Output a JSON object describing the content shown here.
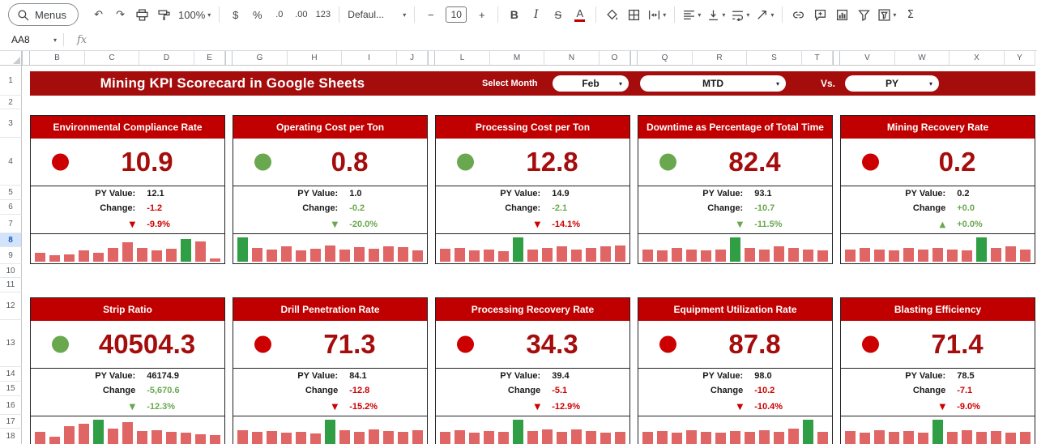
{
  "toolbar": {
    "menus_label": "Menus",
    "zoom_value": "100%",
    "currency_label": "$",
    "percent_label": "%",
    "decrease_decimal_label": ".0",
    "increase_decimal_label": ".00",
    "number_format_label": "123",
    "font_family_value": "Defaul...",
    "decrease_font_label": "−",
    "font_size_value": "10",
    "increase_font_label": "+",
    "bold_label": "B",
    "italic_label": "I",
    "strikethrough_label": "S",
    "text_color_label": "A",
    "functions_label": "Σ"
  },
  "icons": {
    "undo": "↶",
    "redo": "↷",
    "dropdown": "▾"
  },
  "formula_bar": {
    "name_box_value": "AA8",
    "fx_label": "fx"
  },
  "grid": {
    "column_groups": [
      [
        "B",
        "C",
        "D",
        "E"
      ],
      [
        "G",
        "H",
        "I",
        "J"
      ],
      [
        "L",
        "M",
        "N",
        "O"
      ],
      [
        "Q",
        "R",
        "S",
        "T"
      ],
      [
        "V",
        "W",
        "X",
        "Y"
      ]
    ],
    "row_numbers": [
      "1",
      "2",
      "3",
      "4",
      "5",
      "6",
      "7",
      "8",
      "9",
      "10",
      "11",
      "12",
      "13",
      "14",
      "15",
      "16",
      "17",
      "18"
    ],
    "highlighted_row": "8"
  },
  "banner": {
    "title": "Mining KPI Scorecard in Google Sheets",
    "select_month_label": "Select Month",
    "month_value": "Feb",
    "period_value": "MTD",
    "vs_label": "Vs.",
    "compare_value": "PY"
  },
  "cards": [
    {
      "title": "Environmental Compliance Rate",
      "indicator": "red",
      "value": "10.9",
      "py_label": "PY Value:",
      "py_value": "12.1",
      "change_label": "Change:",
      "change_value": "-1.2",
      "change_color": "red",
      "arrow": "▼",
      "pct": "-9.9%",
      "pct_color": "red",
      "spark": {
        "values": [
          35,
          25,
          30,
          46,
          36,
          56,
          76,
          56,
          46,
          52,
          90,
          80,
          14
        ],
        "green_index": 10
      }
    },
    {
      "title": "Operating Cost per Ton",
      "indicator": "green",
      "value": "0.8",
      "py_label": "PY Value:",
      "py_value": "1.0",
      "change_label": "Change:",
      "change_value": "-0.2",
      "change_color": "green",
      "arrow": "▼",
      "pct": "-20.0%",
      "pct_color": "green",
      "spark": {
        "values": [
          96,
          56,
          48,
          60,
          44,
          52,
          64,
          48,
          58,
          52,
          62,
          58,
          46
        ],
        "green_index": 0
      }
    },
    {
      "title": "Processing Cost per Ton",
      "indicator": "green",
      "value": "12.8",
      "py_label": "PY Value:",
      "py_value": "14.9",
      "change_label": "Change:",
      "change_value": "-2.1",
      "change_color": "green",
      "arrow": "▼",
      "pct": "-14.1%",
      "pct_color": "red",
      "spark": {
        "values": [
          52,
          56,
          44,
          50,
          42,
          96,
          50,
          56,
          62,
          50,
          56,
          60,
          66
        ],
        "green_index": 5
      }
    },
    {
      "title": "Downtime as Percentage of Total Time",
      "indicator": "green",
      "value": "82.4",
      "py_label": "PY Value:",
      "py_value": "93.1",
      "change_label": "Change:",
      "change_value": "-10.7",
      "change_color": "green",
      "arrow": "▼",
      "pct": "-11.5%",
      "pct_color": "green",
      "spark": {
        "values": [
          50,
          44,
          56,
          50,
          44,
          50,
          96,
          56,
          50,
          62,
          56,
          50,
          44
        ],
        "green_index": 6
      }
    },
    {
      "title": "Mining Recovery Rate",
      "indicator": "red",
      "value": "0.2",
      "py_label": "PY Value:",
      "py_value": "0.2",
      "change_label": "Change",
      "change_value": "+0.0",
      "change_color": "green",
      "arrow": "▲",
      "pct": "+0.0%",
      "pct_color": "green",
      "spark": {
        "values": [
          50,
          56,
          50,
          44,
          56,
          50,
          56,
          50,
          44,
          96,
          56,
          62,
          50
        ],
        "green_index": 9
      }
    },
    {
      "title": "Strip Ratio",
      "indicator": "green",
      "value": "40504.3",
      "py_label": "PY Value:",
      "py_value": "46174.9",
      "change_label": "Change",
      "change_value": "-5,670.6",
      "change_color": "green",
      "arrow": "▼",
      "pct": "-12.3%",
      "pct_color": "green",
      "spark": {
        "values": [
          50,
          30,
          70,
          80,
          96,
          60,
          88,
          52,
          56,
          48,
          44,
          40,
          34
        ],
        "green_index": 4
      }
    },
    {
      "title": "Drill Penetration Rate",
      "indicator": "red",
      "value": "71.3",
      "py_label": "PY Value:",
      "py_value": "84.1",
      "change_label": "Change",
      "change_value": "-12.8",
      "change_color": "red",
      "arrow": "▼",
      "pct": "-15.2%",
      "pct_color": "red",
      "spark": {
        "values": [
          56,
          48,
          52,
          44,
          50,
          42,
          96,
          56,
          48,
          58,
          52,
          48,
          56
        ],
        "green_index": 6
      }
    },
    {
      "title": "Processing Recovery Rate",
      "indicator": "red",
      "value": "34.3",
      "py_label": "PY Value:",
      "py_value": "39.4",
      "change_label": "Change",
      "change_value": "-5.1",
      "change_color": "red",
      "arrow": "▼",
      "pct": "-12.9%",
      "pct_color": "red",
      "spark": {
        "values": [
          50,
          56,
          44,
          52,
          48,
          96,
          52,
          58,
          50,
          58,
          52,
          46,
          50
        ],
        "green_index": 5
      }
    },
    {
      "title": "Equipment Utilization Rate",
      "indicator": "red",
      "value": "87.8",
      "py_label": "PY Value:",
      "py_value": "98.0",
      "change_label": "Change",
      "change_value": "-10.2",
      "change_color": "red",
      "arrow": "▼",
      "pct": "-10.4%",
      "pct_color": "red",
      "spark": {
        "values": [
          48,
          52,
          46,
          56,
          50,
          44,
          52,
          48,
          56,
          50,
          62,
          96,
          50
        ],
        "green_index": 11
      }
    },
    {
      "title": "Blasting Efficiency",
      "indicator": "red",
      "value": "71.4",
      "py_label": "PY Value:",
      "py_value": "78.5",
      "change_label": "Change",
      "change_value": "-7.1",
      "change_color": "red",
      "arrow": "▼",
      "pct": "-9.0%",
      "pct_color": "red",
      "spark": {
        "values": [
          52,
          46,
          56,
          48,
          52,
          44,
          96,
          50,
          56,
          48,
          52,
          46,
          50
        ],
        "green_index": 6
      }
    }
  ],
  "colors": {
    "banner_red": "#a50d0d",
    "card_header_red": "#c00000",
    "kpi_value_red": "#a50d0d",
    "negative_red": "#cc0000",
    "positive_green": "#6aa84f",
    "spark_bar_pink": "#e06666",
    "spark_bar_green": "#2f9e44",
    "row_highlight_blue": "#d2e3fc"
  }
}
